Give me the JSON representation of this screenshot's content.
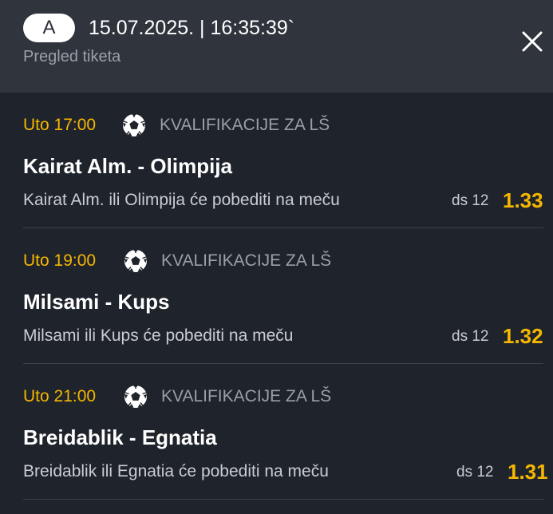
{
  "header": {
    "badge": "A",
    "datetime": "15.07.2025. | 16:35:39`",
    "subtitle": "Pregled tiketa",
    "close_icon": "close-icon"
  },
  "colors": {
    "accent": "#f5b700",
    "header_bg": "#2f343d",
    "body_bg": "#1f232b"
  },
  "matches": [
    {
      "time": "Uto 17:00",
      "sport_icon": "soccer-ball-icon",
      "league": "KVALIFIKACIJE ZA LŠ",
      "teams": "Kairat Alm. - Olimpija",
      "pick": "Kairat Alm. ili Olimpija će pobediti na meču",
      "code": "ds 12",
      "odds": "1.33"
    },
    {
      "time": "Uto 19:00",
      "sport_icon": "soccer-ball-icon",
      "league": "KVALIFIKACIJE ZA LŠ",
      "teams": "Milsami - Kups",
      "pick": "Milsami ili Kups će pobediti na meču",
      "code": "ds 12",
      "odds": "1.32"
    },
    {
      "time": "Uto 21:00",
      "sport_icon": "soccer-ball-icon",
      "league": "KVALIFIKACIJE ZA LŠ",
      "teams": "Breidablik - Egnatia",
      "pick": "Breidablik ili Egnatia će pobediti na meču",
      "code": "ds 12",
      "odds": "1.31"
    }
  ]
}
